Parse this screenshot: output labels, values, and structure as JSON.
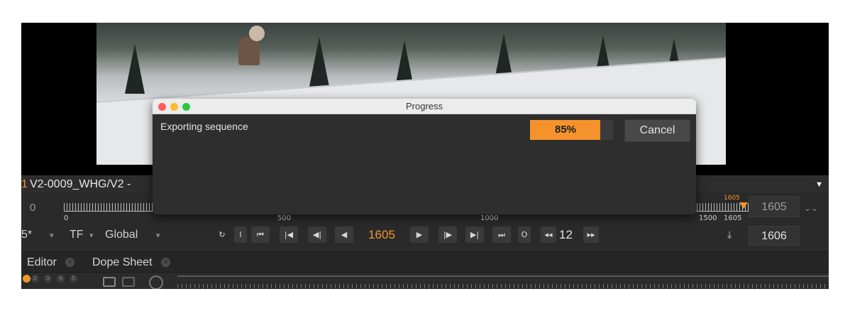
{
  "dialog": {
    "title": "Progress",
    "message": "Exporting sequence",
    "progress_percent": 85,
    "progress_label": "85%",
    "cancel_label": "Cancel"
  },
  "viewer": {
    "frame_index": "1",
    "sequence_name": "V2-0009_WHG/V2 -"
  },
  "timeline": {
    "start_value": "0",
    "ticks": [
      "0",
      "500",
      "1000",
      "1500",
      "1605"
    ],
    "cursor_label": "1605",
    "end_frame": "1605"
  },
  "transport": {
    "left_partial": "5*",
    "tf_label": "TF",
    "scope_label": "Global",
    "in_button": "I",
    "out_button": "O",
    "current_frame": "1605",
    "fps": "12",
    "out_frame": "1606"
  },
  "tabs": [
    {
      "label": "Editor"
    },
    {
      "label": "Dope Sheet"
    }
  ],
  "bottom_numbers": [
    "2",
    "3",
    "4",
    "5"
  ],
  "colors": {
    "accent": "#f0962a",
    "progress": "#f5922b",
    "close_red": "#ff5f57",
    "minimize_yellow": "#febc2e",
    "zoom_green": "#28c840"
  }
}
